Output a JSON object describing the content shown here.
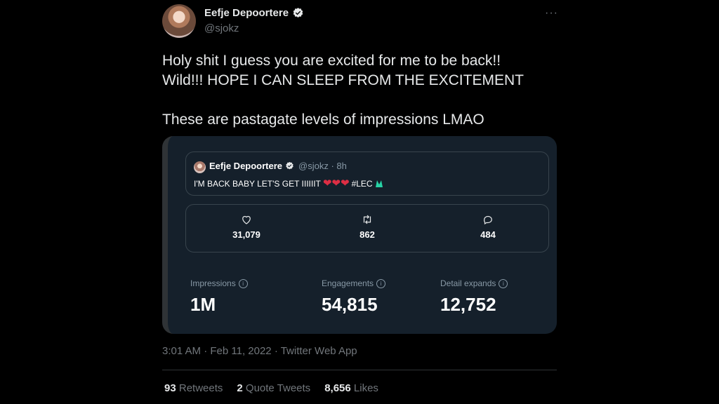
{
  "author": {
    "display_name": "Eefje Depoortere",
    "handle": "@sjokz",
    "verified_icon": "verified-badge-icon"
  },
  "tweet": {
    "text": "Holy shit I guess you are excited for me to be back!!\nWild!!! HOPE I  CAN SLEEP FROM THE EXCITEMENT\n\nThese are pastagate levels of impressions LMAO",
    "timestamp": "3:01 AM · Feb 11, 2022 · Twitter Web App",
    "more_icon": "···"
  },
  "screenshot": {
    "quoted": {
      "name": "Eefje Depoortere",
      "meta": "@sjokz · 8h",
      "text": "I'M BACK BABY LET'S GET IIIIIIT",
      "hashtag": "#LEC"
    },
    "stats": {
      "likes": "31,079",
      "retweets": "862",
      "replies": "484"
    },
    "metrics": [
      {
        "label": "Impressions",
        "value": "1M"
      },
      {
        "label": "Engagements",
        "value": "54,815"
      },
      {
        "label": "Detail expands",
        "value": "12,752"
      }
    ]
  },
  "counts": {
    "retweets": {
      "num": "93",
      "label": "Retweets"
    },
    "quotes": {
      "num": "2",
      "label": "Quote Tweets"
    },
    "likes": {
      "num": "8,656",
      "label": "Likes"
    }
  },
  "colors": {
    "background": "#000000",
    "media_bg": "#15202b",
    "verified": "#1d9bf0",
    "muted": "#71767b"
  }
}
